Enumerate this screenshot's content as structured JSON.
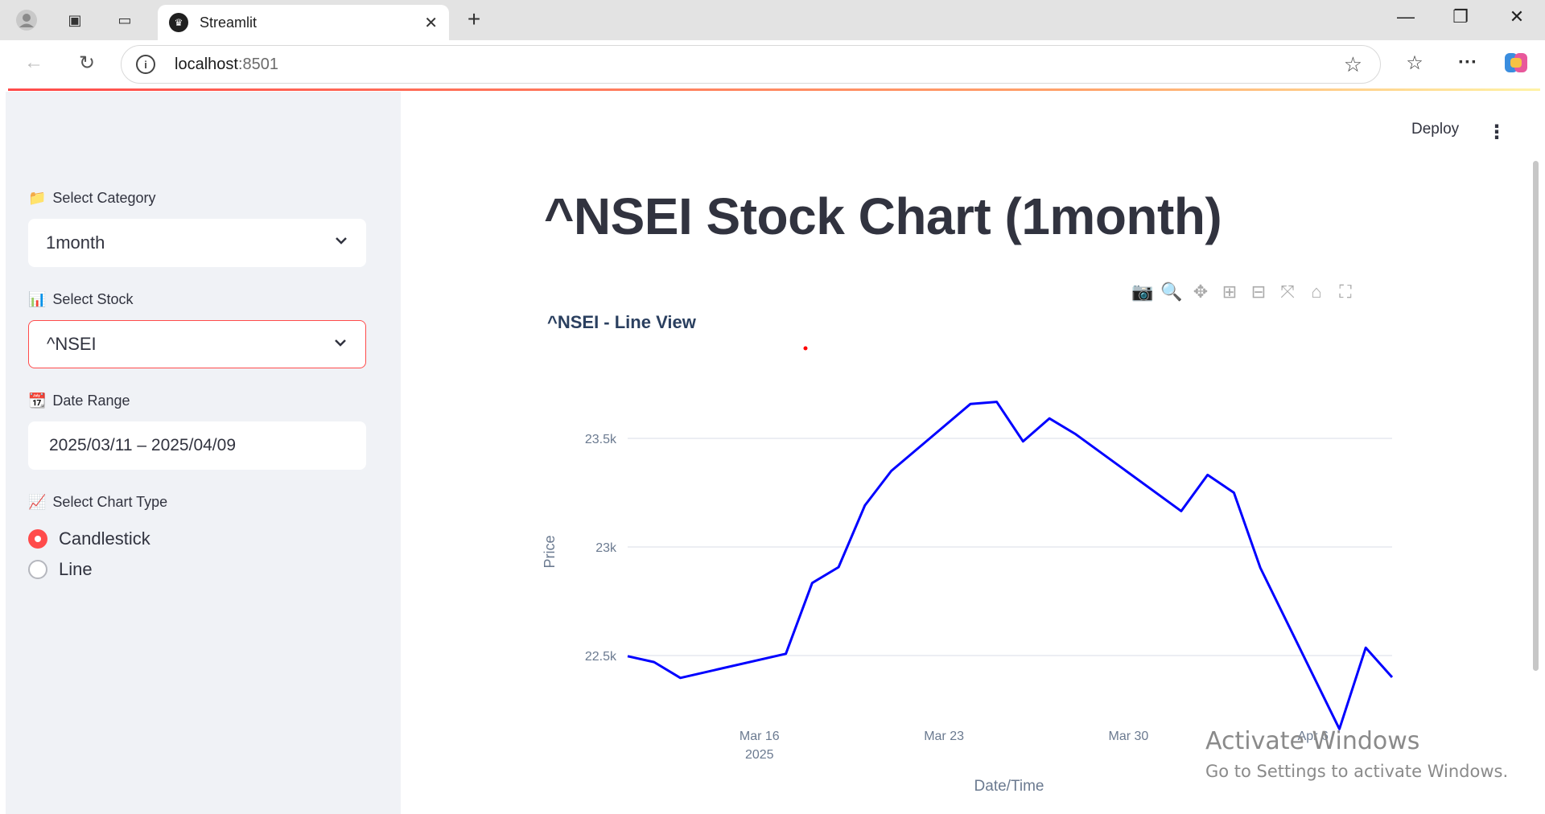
{
  "browser": {
    "tab_title": "Streamlit",
    "url_host": "localhost",
    "url_port": ":8501"
  },
  "header": {
    "deploy_label": "Deploy"
  },
  "sidebar": {
    "category_label": "Select Category",
    "category_value": "1month",
    "stock_label": "Select Stock",
    "stock_value": "^NSEI",
    "date_label": "Date Range",
    "date_value": "2025/03/11 – 2025/04/09",
    "charttype_label": "Select Chart Type",
    "charttype_options": [
      "Candlestick",
      "Line"
    ],
    "charttype_selected": "Candlestick"
  },
  "main": {
    "title": "^NSEI Stock Chart (1month)"
  },
  "watermark": {
    "line1": "Activate Windows",
    "line2": "Go to Settings to activate Windows."
  },
  "chart_data": {
    "type": "line",
    "title": "^NSEI - Line View",
    "xlabel": "Date/Time",
    "ylabel": "Price",
    "x_ticks": [
      "Mar 16",
      "Mar 23",
      "Mar 30",
      "Apr 6"
    ],
    "x_tick_sublabel": "2025",
    "y_ticks": [
      22500,
      23000,
      23500
    ],
    "y_tick_labels": [
      "22.5k",
      "23k",
      "23.5k"
    ],
    "ylim": [
      22000,
      24000
    ],
    "grid": true,
    "series_color": "#0000ff",
    "series": [
      {
        "x": [
          "2025-03-11",
          "2025-03-12",
          "2025-03-13",
          "2025-03-17",
          "2025-03-18",
          "2025-03-19",
          "2025-03-20",
          "2025-03-21",
          "2025-03-24",
          "2025-03-25",
          "2025-03-26",
          "2025-03-27",
          "2025-03-28",
          "2025-04-01",
          "2025-04-02",
          "2025-04-03",
          "2025-04-04",
          "2025-04-07",
          "2025-04-08",
          "2025-04-09"
        ],
        "values": [
          22497,
          22470,
          22397,
          22508,
          22834,
          22907,
          23191,
          23350,
          23658,
          23668,
          23486,
          23592,
          23519,
          23165,
          23332,
          23250,
          22904,
          22162,
          22536,
          22400
        ]
      }
    ]
  }
}
